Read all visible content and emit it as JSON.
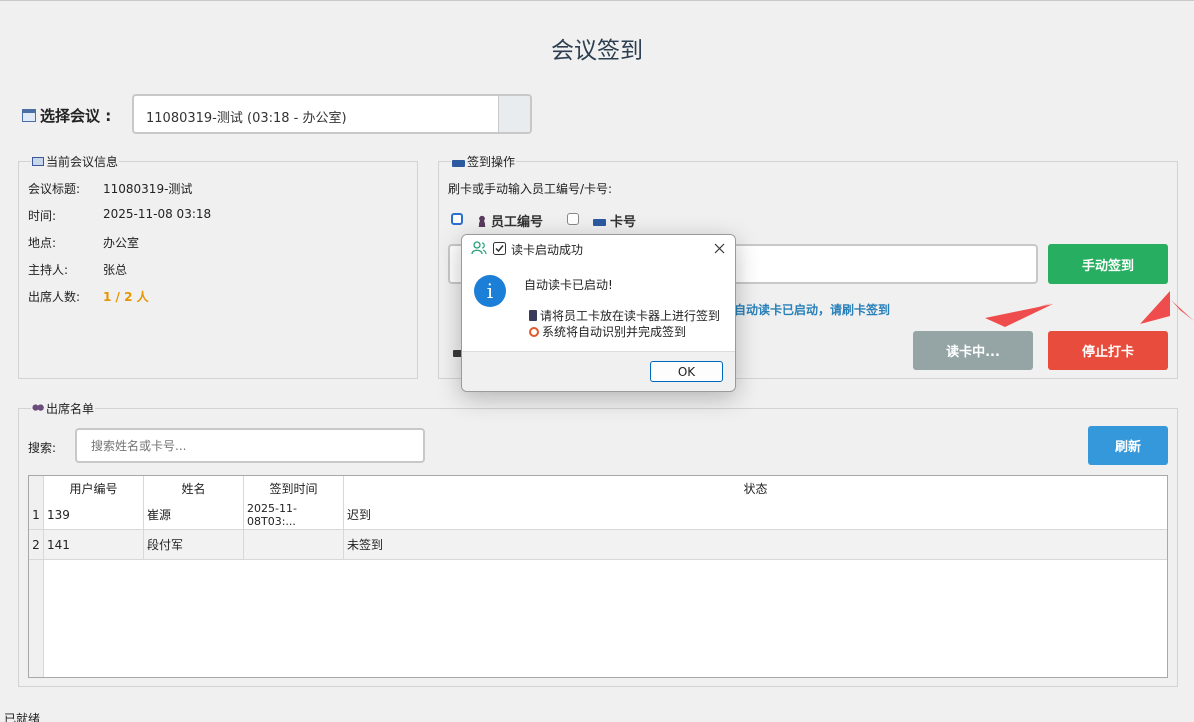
{
  "title": "会议签到",
  "meeting_select": {
    "label": "选择会议 :",
    "value": "11080319-测试 (03:18 - 办公室)"
  },
  "current_meeting": {
    "group_title": "当前会议信息",
    "fields": [
      {
        "key": "会议标题:",
        "value": "11080319-测试"
      },
      {
        "key": "时间:",
        "value": "2025-11-08 03:18"
      },
      {
        "key": "地点:",
        "value": "办公室"
      },
      {
        "key": "主持人:",
        "value": "张总"
      },
      {
        "key": "出席人数:",
        "value": "1 / 2 人"
      }
    ]
  },
  "checkin": {
    "group_title": "签到操作",
    "instruction": "刷卡或手动输入员工编号/卡号:",
    "option_employee": "员工编号",
    "option_card": "卡号",
    "manual_button": "手动签到",
    "status_text": "自动读卡已启动，请刷卡签到",
    "reading_button": "读卡中...",
    "stop_button": "停止打卡"
  },
  "attendees": {
    "group_title": "出席名单",
    "search_label": "搜索:",
    "search_placeholder": "搜索姓名或卡号...",
    "refresh_button": "刷新",
    "columns": [
      "用户编号",
      "姓名",
      "签到时间",
      "状态"
    ],
    "rows": [
      {
        "num": "1",
        "id": "139",
        "name": "崔源",
        "time": "2025-11-08T03:...",
        "status": "迟到"
      },
      {
        "num": "2",
        "id": "141",
        "name": "段付军",
        "time": "",
        "status": "未签到"
      }
    ]
  },
  "status_bar": "已就绪",
  "dialog": {
    "title": "读卡启动成功",
    "heading": "自动读卡已启动!",
    "line1": "请将员工卡放在读卡器上进行签到",
    "line2": "系统将自动识别并完成签到",
    "ok": "OK"
  },
  "colors": {
    "accent_green": "#27ae60",
    "accent_red": "#e74c3c",
    "accent_blue": "#3498db",
    "status_blue": "#2980b9",
    "attendance_orange": "#e69500"
  }
}
